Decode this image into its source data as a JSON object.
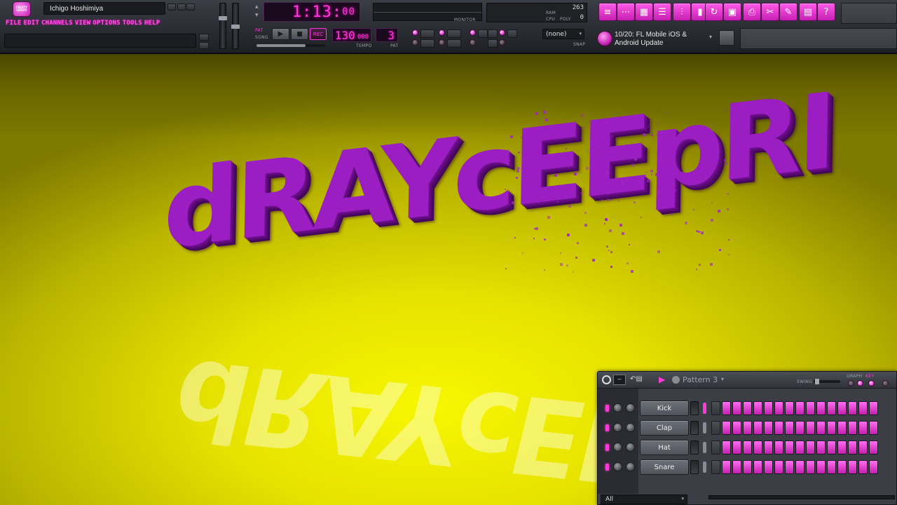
{
  "app": {
    "logo_text": "FRUITY LOOPS",
    "project_name": "Ichigo Hoshimiya",
    "menu": [
      "File",
      "Edit",
      "Channels",
      "View",
      "Options",
      "Tools",
      "Help"
    ]
  },
  "transport": {
    "time_display": "1:13:00",
    "time_bars": "1",
    "time_beats": "13",
    "time_ticks": "00",
    "tempo": "130",
    "tempo_decimal": "000",
    "tempo_label": "TEMPO",
    "pattern_number": "3",
    "pattern_label": "PAT",
    "rec_label": "REC",
    "monitor_label": "MONITOR",
    "mode_pat": "PAT",
    "mode_song": "SONG",
    "snap_value": "(none)",
    "snap_label": "SNAP"
  },
  "meters": {
    "ram_value": "263",
    "cpu_label": "CPU",
    "poly_label": "POLY",
    "poly_value": "0",
    "ram_label": "RAM"
  },
  "news": {
    "text": "10/20: FL Mobile iOS & Android Update"
  },
  "canvas": {
    "logo_text": "dRAYcEEpRI"
  },
  "sequencer": {
    "pattern_name": "Pattern 3",
    "swing_label": "SWING",
    "graph_label": "GRAPH",
    "kb_label": "KEY",
    "filter": "All",
    "channels": [
      {
        "name": "Kick",
        "steps": [
          0,
          1,
          1,
          1,
          1,
          1,
          1,
          1,
          1,
          1,
          1,
          1,
          1,
          1,
          1,
          1
        ]
      },
      {
        "name": "Clap",
        "steps": [
          0,
          1,
          1,
          1,
          1,
          1,
          1,
          1,
          1,
          1,
          1,
          1,
          1,
          1,
          1,
          1
        ]
      },
      {
        "name": "Hat",
        "steps": [
          0,
          1,
          1,
          1,
          1,
          1,
          1,
          1,
          1,
          1,
          1,
          1,
          1,
          1,
          1,
          1
        ]
      },
      {
        "name": "Snare",
        "steps": [
          0,
          1,
          1,
          1,
          1,
          1,
          1,
          1,
          1,
          1,
          1,
          1,
          1,
          1,
          1,
          1
        ]
      }
    ]
  },
  "colors": {
    "accent": "#ff3ad9",
    "background_yellow": "#e6e200",
    "logo_purple": "#9a1ec2",
    "ui_dark": "#2a2d33"
  }
}
